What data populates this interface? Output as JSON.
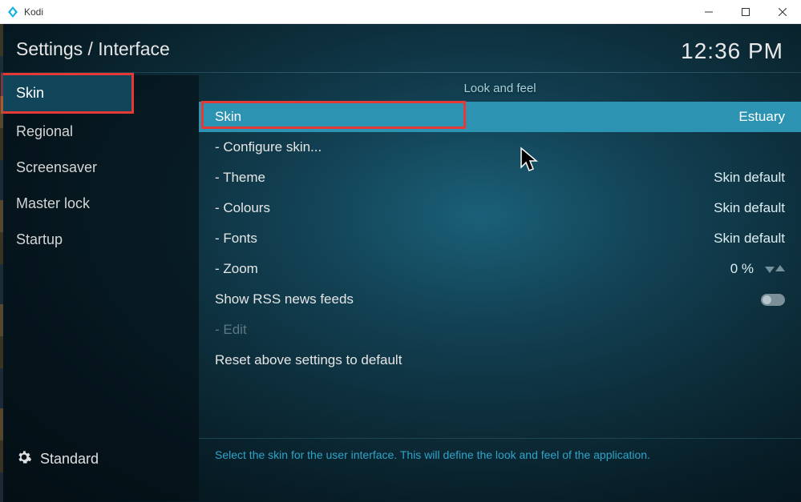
{
  "window": {
    "title": "Kodi",
    "minimize": "—",
    "maximize": "☐",
    "close": "✕"
  },
  "header": {
    "breadcrumb": "Settings / Interface",
    "time": "12:36 PM"
  },
  "sidebar": {
    "items": [
      {
        "label": "Skin",
        "active": true
      },
      {
        "label": "Regional",
        "active": false
      },
      {
        "label": "Screensaver",
        "active": false
      },
      {
        "label": "Master lock",
        "active": false
      },
      {
        "label": "Startup",
        "active": false
      }
    ],
    "footer": "Standard"
  },
  "main": {
    "section_title": "Look and feel",
    "rows": [
      {
        "label": "Skin",
        "value": "Estuary",
        "selected": true
      },
      {
        "label": "- Configure skin...",
        "value": ""
      },
      {
        "label": "- Theme",
        "value": "Skin default"
      },
      {
        "label": "- Colours",
        "value": "Skin default"
      },
      {
        "label": "- Fonts",
        "value": "Skin default"
      },
      {
        "label": "- Zoom",
        "value": "0 %",
        "arrows": true
      },
      {
        "label": "Show RSS news feeds",
        "toggle": true
      },
      {
        "label": "- Edit",
        "disabled": true
      },
      {
        "label": "Reset above settings to default",
        "value": ""
      }
    ],
    "help": "Select the skin for the user interface. This will define the look and feel of the application."
  }
}
